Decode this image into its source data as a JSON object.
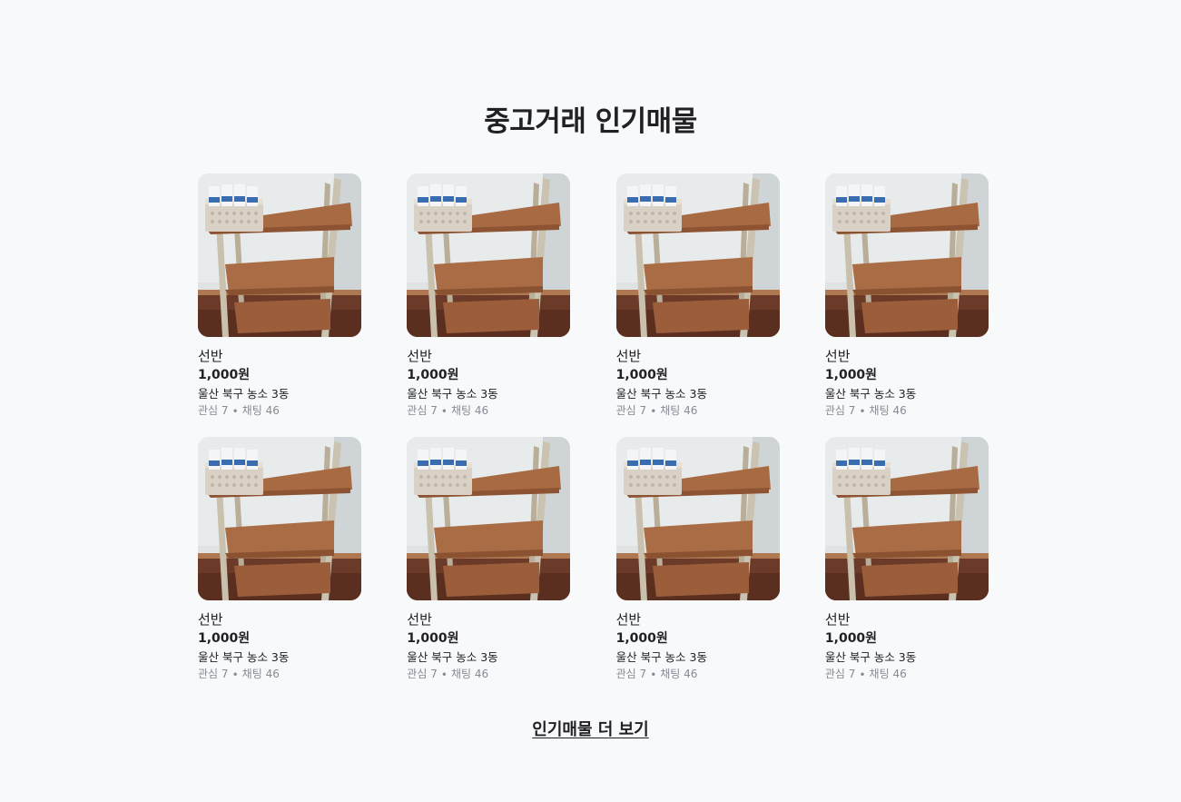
{
  "section": {
    "title": "중고거래 인기매물",
    "more_label": "인기매물 더 보기"
  },
  "items": [
    {
      "title": "선반",
      "price": "1,000원",
      "region": "울산 북구 농소 3동",
      "counts": "관심 7 ∙ 채팅 46"
    },
    {
      "title": "선반",
      "price": "1,000원",
      "region": "울산 북구 농소 3동",
      "counts": "관심 7 ∙ 채팅 46"
    },
    {
      "title": "선반",
      "price": "1,000원",
      "region": "울산 북구 농소 3동",
      "counts": "관심 7 ∙ 채팅 46"
    },
    {
      "title": "선반",
      "price": "1,000원",
      "region": "울산 북구 농소 3동",
      "counts": "관심 7 ∙ 채팅 46"
    },
    {
      "title": "선반",
      "price": "1,000원",
      "region": "울산 북구 농소 3동",
      "counts": "관심 7 ∙ 채팅 46"
    },
    {
      "title": "선반",
      "price": "1,000원",
      "region": "울산 북구 농소 3동",
      "counts": "관심 7 ∙ 채팅 46"
    },
    {
      "title": "선반",
      "price": "1,000원",
      "region": "울산 북구 농소 3동",
      "counts": "관심 7 ∙ 채팅 46"
    },
    {
      "title": "선반",
      "price": "1,000원",
      "region": "울산 북구 농소 3동",
      "counts": "관심 7 ∙ 채팅 46"
    }
  ],
  "colors": {
    "background": "#f8f9fa",
    "text": "#212124",
    "muted": "#868b94"
  }
}
